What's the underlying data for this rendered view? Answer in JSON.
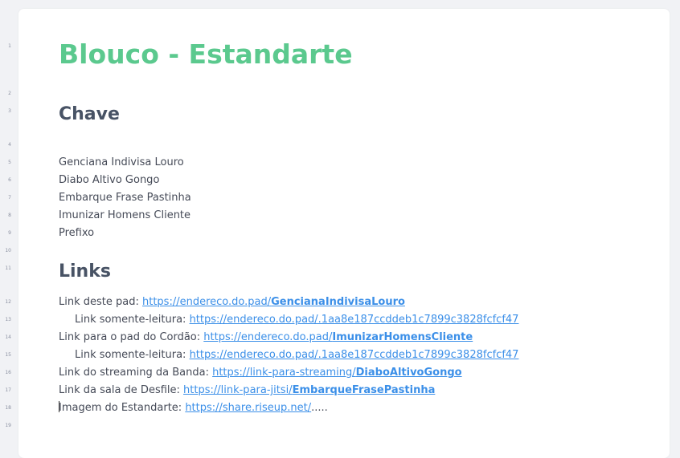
{
  "line_numbers": [
    "1",
    "2",
    "3",
    "4",
    "5",
    "6",
    "7",
    "8",
    "9",
    "10",
    "11",
    "12",
    "13",
    "14",
    "15",
    "16",
    "17",
    "18",
    "19"
  ],
  "document": {
    "title": "Blouco - Estandarte",
    "chave_heading": "Chave",
    "keys": [
      "Genciana Indivisa Louro",
      "Diabo Altivo Gongo",
      "Embarque Frase Pastinha",
      "Imunizar Homens Cliente",
      "Prefixo"
    ],
    "links_heading": "Links",
    "links": [
      {
        "label": "Link deste pad: ",
        "url_prefix": "https://endereco.do.pad/",
        "url_bold": "GencianaIndivisaLouro",
        "suffix": ""
      },
      {
        "label": "Link somente-leitura:  ",
        "url_prefix": "https://endereco.do.pad/.1aa8e187ccddeb1c7899c3828fcfcf47",
        "url_bold": "",
        "suffix": ""
      },
      {
        "label": "Link para o pad do Cordão: ",
        "url_prefix": "https://endereco.do.pad/",
        "url_bold": "ImunizarHomensCliente",
        "suffix": ""
      },
      {
        "label": "Link somente-leitura:  ",
        "url_prefix": "https://endereco.do.pad/.1aa8e187ccddeb1c7899c3828fcfcf47",
        "url_bold": "",
        "suffix": ""
      },
      {
        "label": "Link do streaming da Banda:  ",
        "url_prefix": "https://link-para-streaming/",
        "url_bold": "DiaboAltivoGongo",
        "suffix": ""
      },
      {
        "label": "Link da sala de Desfile: ",
        "url_prefix": "https://link-para-jitsi/",
        "url_bold": "EmbarqueFrasePastinha",
        "suffix": ""
      },
      {
        "label": "Imagem do Estandarte: ",
        "url_prefix": "https://share.riseup.net/",
        "url_bold": "",
        "suffix": "....."
      }
    ]
  }
}
